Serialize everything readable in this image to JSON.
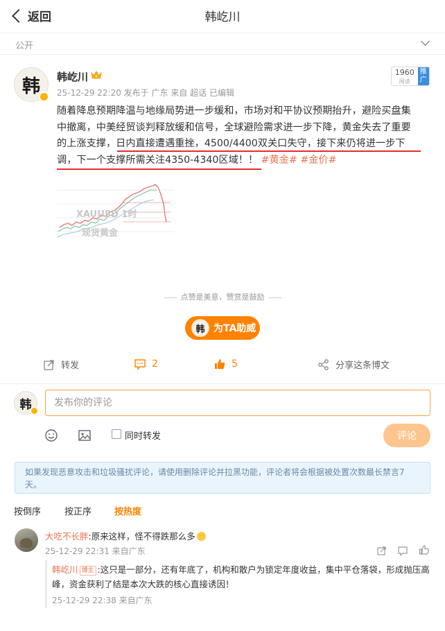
{
  "header": {
    "back_label": "返回",
    "title": "韩屹川"
  },
  "visibility": {
    "label": "公开"
  },
  "post": {
    "author": "韩屹川",
    "avatar_char": "韩",
    "meta": "25-12-29 22:20 发布于 广东 来自 超话 已编辑",
    "rank": {
      "number": "1960",
      "sub": "阅读",
      "tag": "推广"
    },
    "text_lines": [
      "随着降息预期降温与地缘局势进一步缓和，市场对和平协议预期抬升，避险买盘集",
      "中撤离，中美经贸谈判释放缓和信号，全球避险需求进一步下降，黄金失去了重要",
      "的上涨支撑，日内直接遭遇重挫，4500/4400双关口失守，接下来仍将进一步下",
      "调，下一个支撑所需关注4350-4340区域！！"
    ],
    "tags": [
      "#黄金#",
      "#金价#"
    ],
    "image_watermarks": [
      "XAUUSD 1时",
      "现货黄金"
    ]
  },
  "praise": {
    "text": "点赞是美意，赞赏是鼓励",
    "cheer_label": "为TA助威"
  },
  "actions": {
    "forward": "转发",
    "comments": "2",
    "likes": "5",
    "share": "分享这条博文"
  },
  "composer": {
    "placeholder": "发布你的评论",
    "repost_label": "同时转发",
    "submit_label": "评论"
  },
  "notice": "如果发现恶意攻击和垃圾骚扰评论，请使用删除评论并拉黑功能，评论者将会根据被处置次数最长禁言7天。",
  "sort": {
    "desc": "按倒序",
    "asc": "按正序",
    "hot": "按热度"
  },
  "comments": [
    {
      "user": "大吃不长胖",
      "text": ":原来这样，怪不得跌那么多",
      "meta": "25-12-29 22:31 来自广东",
      "reply": {
        "user": "韩屹川",
        "tag": "博主",
        "text": ":这只是一部分，还有年底了，机构和散户为锁定年度收益，集中平仓落袋，形成抛压高峰，资金获利了结是本次大跌的核心直接诱因！",
        "meta": "25-12-29 22:38 来自广东"
      }
    }
  ],
  "colors": {
    "accent": "#ff8200",
    "link": "#eb7350",
    "underline": "#e52b2b"
  }
}
